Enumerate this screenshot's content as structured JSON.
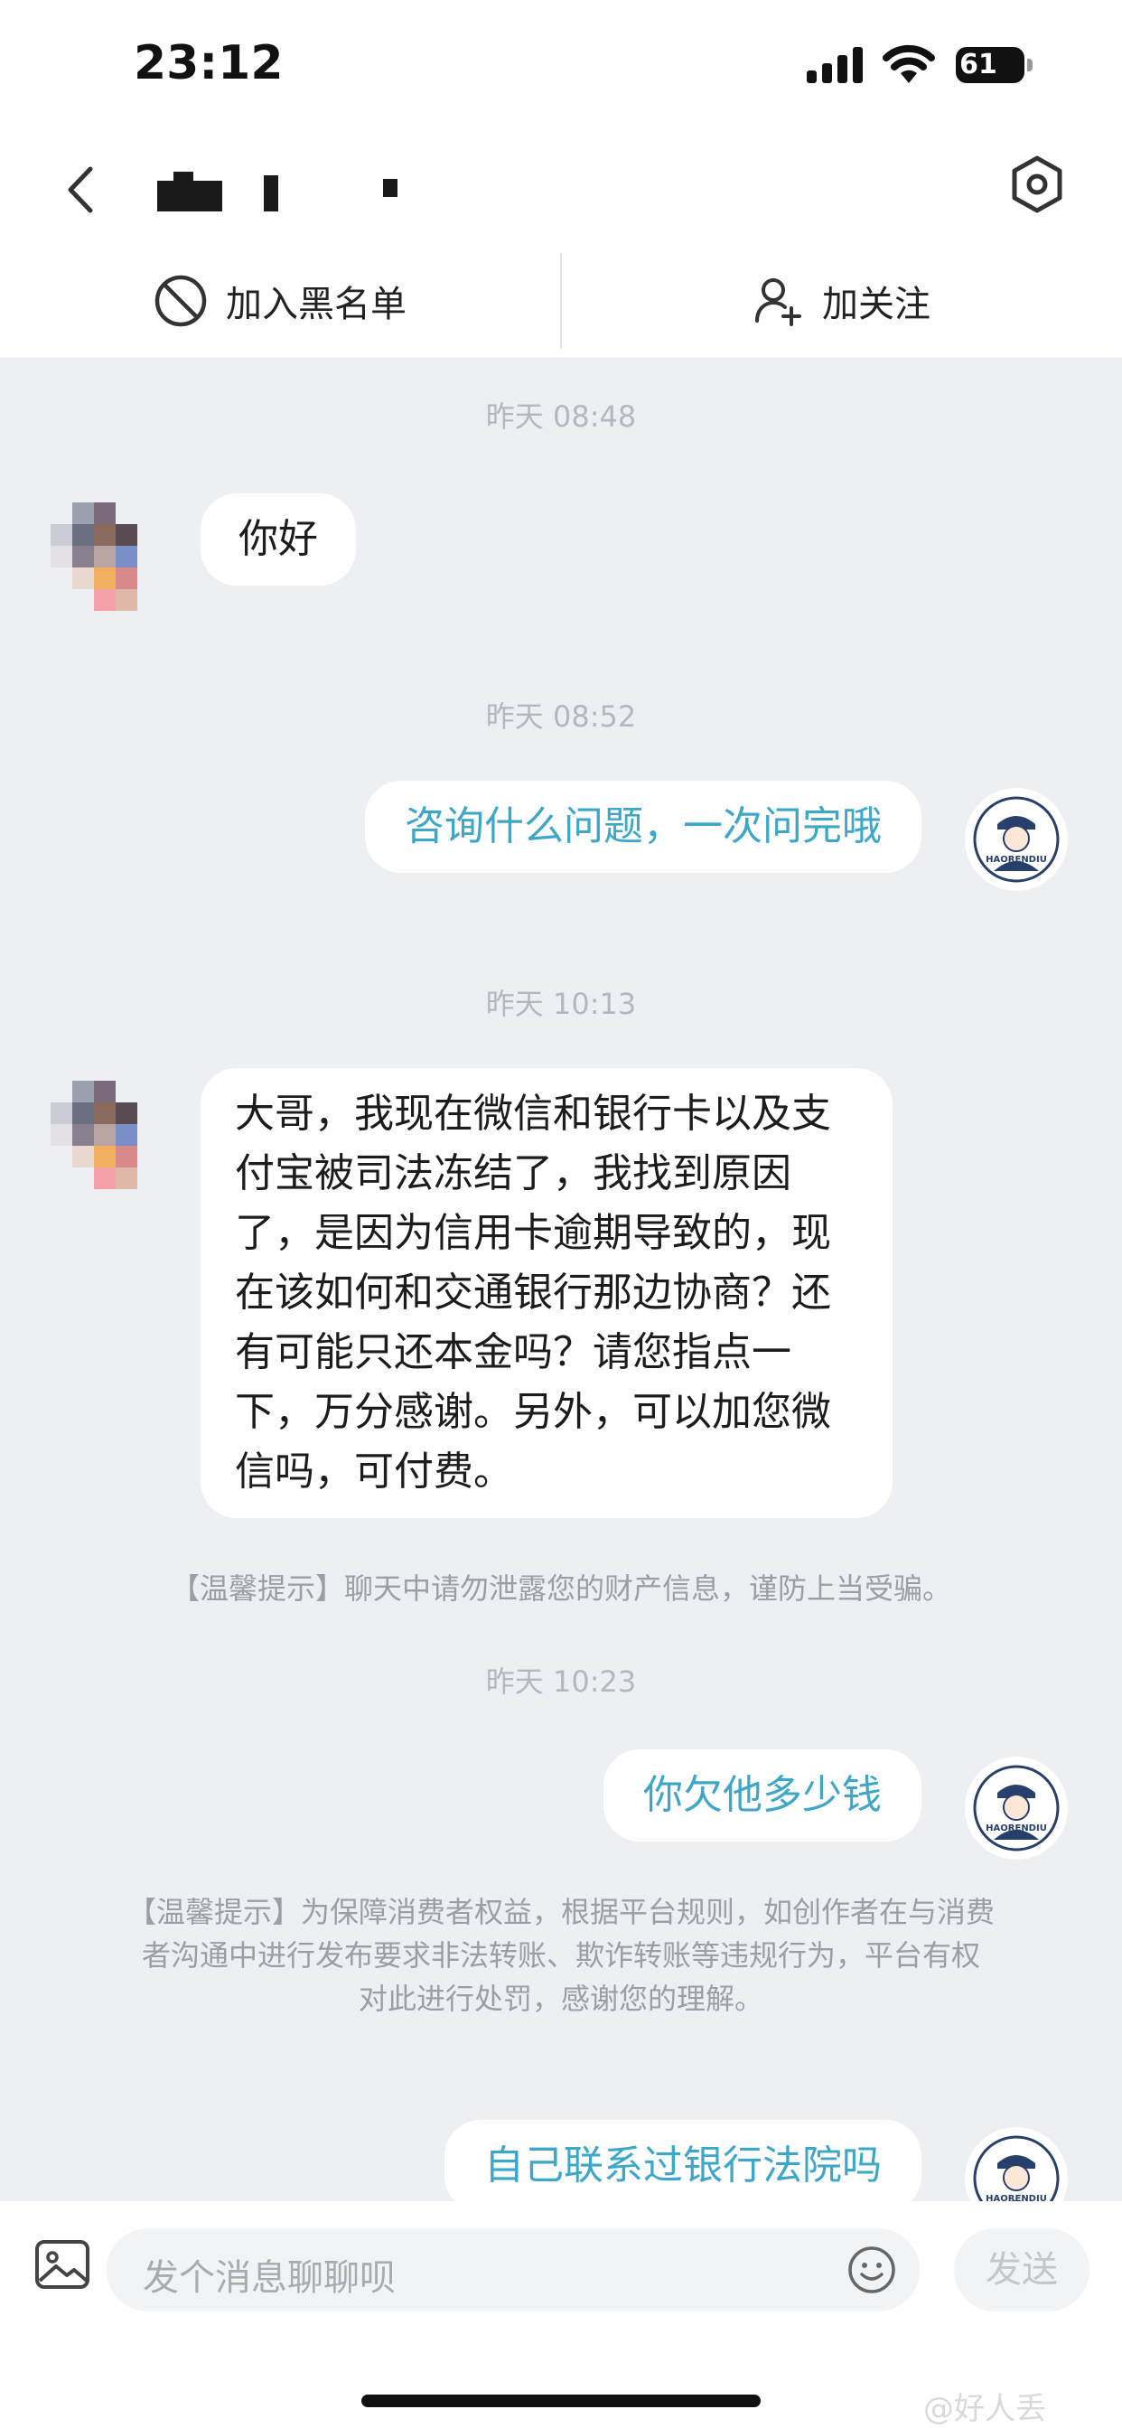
{
  "status_bar": {
    "time": "23:12",
    "battery": "61"
  },
  "header": {
    "back_icon": "chevron-left-icon",
    "settings_icon": "hexagon-settings-icon"
  },
  "actions": {
    "block_label": "加入黑名单",
    "follow_label": "加关注"
  },
  "messages": [
    {
      "type": "timestamp",
      "text": "昨天 08:48"
    },
    {
      "type": "incoming",
      "lines": [
        "你好"
      ]
    },
    {
      "type": "timestamp",
      "text": "昨天 08:52"
    },
    {
      "type": "outgoing",
      "lines": [
        "咨询什么问题，一次问完哦"
      ]
    },
    {
      "type": "timestamp",
      "text": "昨天 10:13"
    },
    {
      "type": "incoming",
      "lines": [
        "大哥，我现在微信和银行卡以及支",
        "付宝被司法冻结了，我找到原因",
        "了，是因为信用卡逾期导致的，现",
        "在该如何和交通银行那边协商？还",
        "有可能只还本金吗？请您指点一",
        "下，万分感谢。另外，可以加您微",
        "信吗，可付费。"
      ]
    },
    {
      "type": "tip",
      "lines": [
        "【温馨提示】聊天中请勿泄露您的财产信息，谨防上当受骗。"
      ]
    },
    {
      "type": "timestamp",
      "text": "昨天 10:23"
    },
    {
      "type": "outgoing",
      "lines": [
        "你欠他多少钱"
      ]
    },
    {
      "type": "tip",
      "lines": [
        "【温馨提示】为保障消费者权益，根据平台规则，如创作者在与消费",
        "者沟通中进行发布要求非法转账、欺诈转账等违规行为，平台有权",
        "对此进行处罚，感谢您的理解。"
      ]
    },
    {
      "type": "outgoing",
      "lines": [
        "自己联系过银行法院吗"
      ]
    }
  ],
  "avatar_text": "HAORENDIU",
  "input": {
    "placeholder": "发个消息聊聊呗",
    "send_label": "发送"
  },
  "watermark": "@好人丢"
}
